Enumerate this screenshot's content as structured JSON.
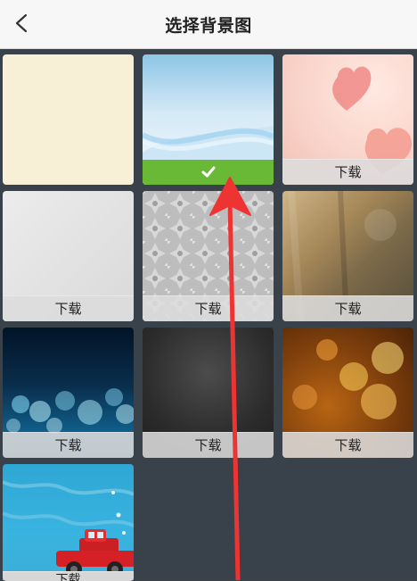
{
  "header": {
    "title": "选择背景图"
  },
  "tiles": [
    {
      "name": "cream",
      "label": ""
    },
    {
      "name": "sky-wave",
      "label": "",
      "selected": true
    },
    {
      "name": "pink-hearts",
      "label": "下载"
    },
    {
      "name": "silver",
      "label": "下载"
    },
    {
      "name": "lace-pattern",
      "label": "下载"
    },
    {
      "name": "frosted-glass",
      "label": "下载"
    },
    {
      "name": "night-bokeh",
      "label": "下载"
    },
    {
      "name": "dark-texture",
      "label": "下载"
    },
    {
      "name": "orange-bokeh",
      "label": "下载"
    },
    {
      "name": "car-illustration",
      "label": "下载"
    }
  ],
  "icons": {
    "back": "chevron-left-icon",
    "check": "check-icon",
    "arrow": "red-arrow-annotation"
  },
  "colors": {
    "selected": "#69b937",
    "arrow": "#ee3333"
  }
}
